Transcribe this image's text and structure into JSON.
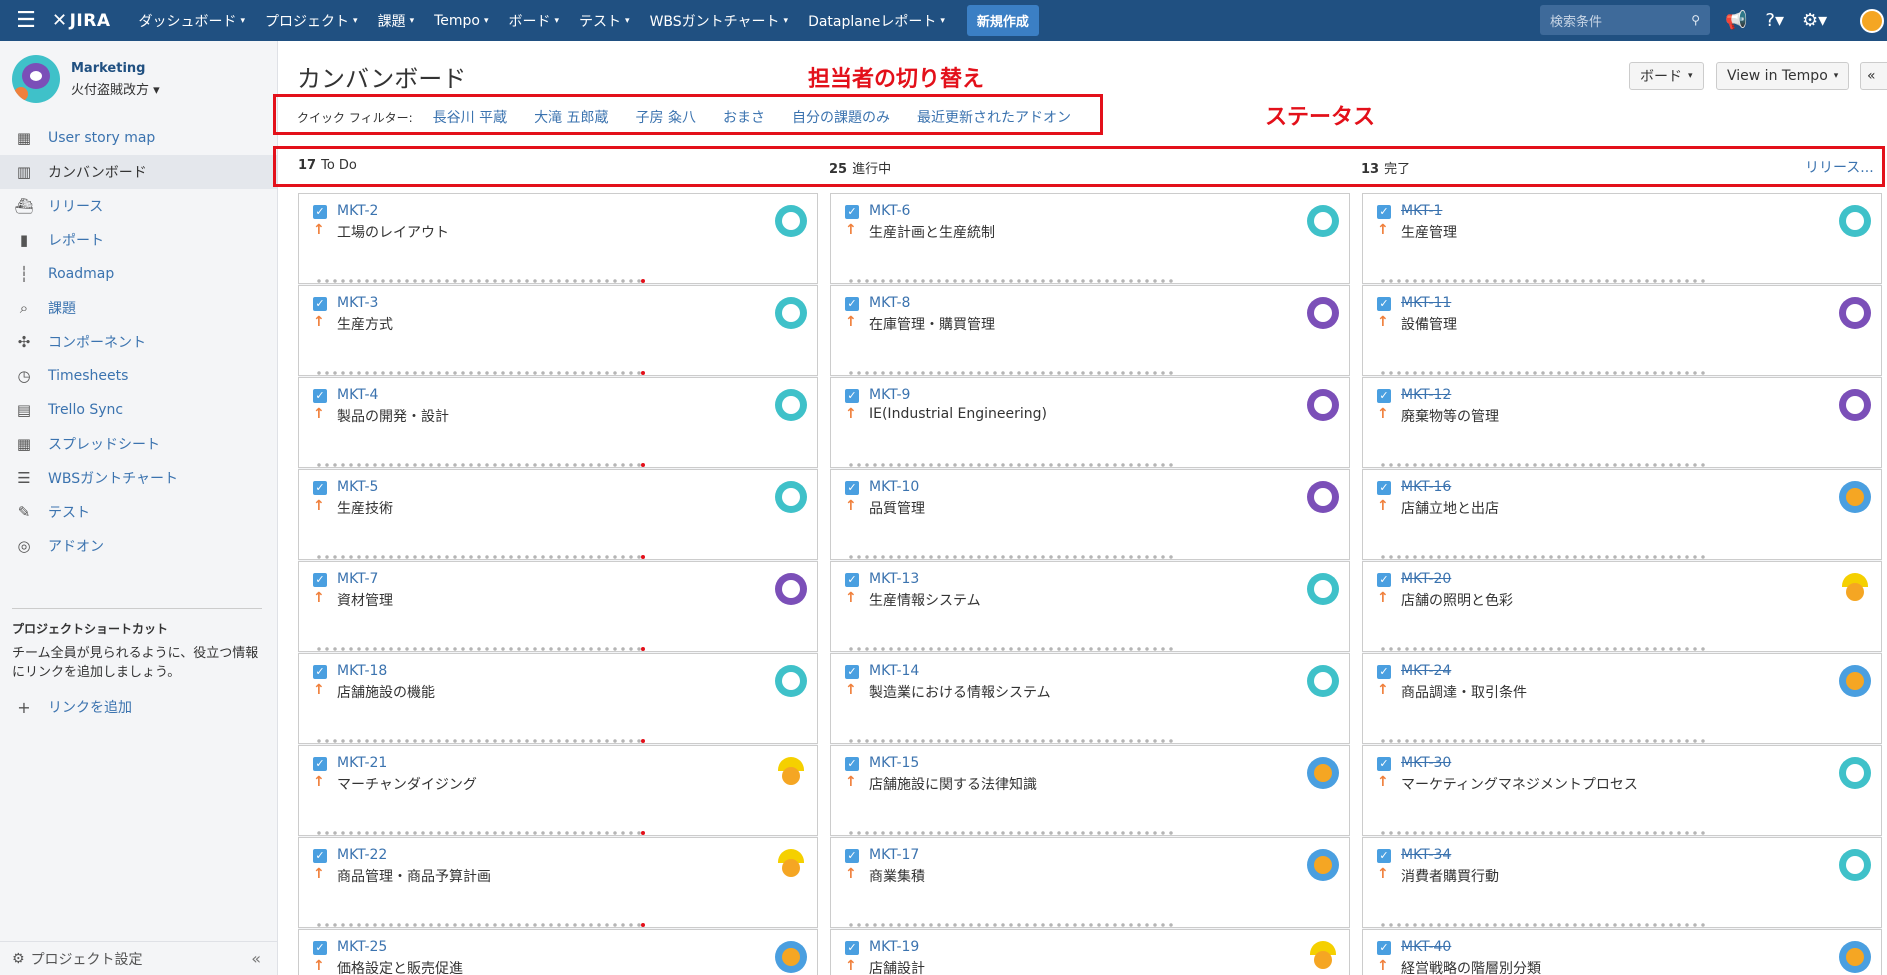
{
  "nav": {
    "logo": "JIRA",
    "items": [
      "ダッシュボード",
      "プロジェクト",
      "課題",
      "Tempo",
      "ボード",
      "テスト",
      "WBSガントチャート",
      "Dataplaneレポート"
    ],
    "create": "新規作成",
    "search_placeholder": "検索条件"
  },
  "project": {
    "name": "Marketing",
    "sub": "火付盗賊改方"
  },
  "sidebar": {
    "items": [
      {
        "label": "User story map",
        "icon": "story-map-icon"
      },
      {
        "label": "カンバンボード",
        "icon": "board-icon"
      },
      {
        "label": "リリース",
        "icon": "ship-icon"
      },
      {
        "label": "レポート",
        "icon": "chart-icon"
      },
      {
        "label": "Roadmap",
        "icon": "roadmap-icon"
      },
      {
        "label": "課題",
        "icon": "issues-icon"
      },
      {
        "label": "コンポーネント",
        "icon": "puzzle-icon"
      },
      {
        "label": "Timesheets",
        "icon": "clock-icon"
      },
      {
        "label": "Trello Sync",
        "icon": "trello-icon"
      },
      {
        "label": "スプレッドシート",
        "icon": "table-icon"
      },
      {
        "label": "WBSガントチャート",
        "icon": "gantt-icon"
      },
      {
        "label": "テスト",
        "icon": "test-icon"
      },
      {
        "label": "アドオン",
        "icon": "addon-icon"
      }
    ],
    "shortcut_title": "プロジェクトショートカット",
    "shortcut_text": "チーム全員が見られるように、役立つ情報にリンクを追加しましょう。",
    "add_link": "リンクを追加",
    "settings": "プロジェクト設定"
  },
  "board": {
    "title": "カンバンボード",
    "btn_board": "ボード",
    "btn_tempo": "View in Tempo",
    "annotation_assignee": "担当者の切り替え",
    "annotation_status": "ステータス",
    "quickfilter_label": "クイック フィルター:",
    "quickfilters": [
      "長谷川 平蔵",
      "大滝 五郎蔵",
      "子房 粂八",
      "おまさ",
      "自分の課題のみ",
      "最近更新されたアドオン"
    ],
    "release": "リリース..."
  },
  "columns": [
    {
      "count": "17",
      "name": "To Do",
      "cards": [
        {
          "key": "MKT-2",
          "summary": "工場のレイアウト",
          "avatar": "teal"
        },
        {
          "key": "MKT-3",
          "summary": "生産方式",
          "avatar": "teal"
        },
        {
          "key": "MKT-4",
          "summary": "製品の開発・設計",
          "avatar": "teal"
        },
        {
          "key": "MKT-5",
          "summary": "生産技術",
          "avatar": "teal"
        },
        {
          "key": "MKT-7",
          "summary": "資材管理",
          "avatar": "purple"
        },
        {
          "key": "MKT-18",
          "summary": "店舗施設の機能",
          "avatar": "teal"
        },
        {
          "key": "MKT-21",
          "summary": "マーチャンダイジング",
          "avatar": "worker"
        },
        {
          "key": "MKT-22",
          "summary": "商品管理・商品予算計画",
          "avatar": "worker"
        },
        {
          "key": "MKT-25",
          "summary": "価格設定と販売促進",
          "avatar": "cat"
        }
      ]
    },
    {
      "count": "25",
      "name": "進行中",
      "cards": [
        {
          "key": "MKT-6",
          "summary": "生産計画と生産統制",
          "avatar": "teal"
        },
        {
          "key": "MKT-8",
          "summary": "在庫管理・購買管理",
          "avatar": "purple"
        },
        {
          "key": "MKT-9",
          "summary": "IE(Industrial Engineering)",
          "avatar": "purple"
        },
        {
          "key": "MKT-10",
          "summary": "品質管理",
          "avatar": "purple"
        },
        {
          "key": "MKT-13",
          "summary": "生産情報システム",
          "avatar": "teal"
        },
        {
          "key": "MKT-14",
          "summary": "製造業における情報システム",
          "avatar": "teal"
        },
        {
          "key": "MKT-15",
          "summary": "店舗施設に関する法律知識",
          "avatar": "cat"
        },
        {
          "key": "MKT-17",
          "summary": "商業集積",
          "avatar": "cat"
        },
        {
          "key": "MKT-19",
          "summary": "店舗設計",
          "avatar": "worker"
        }
      ]
    },
    {
      "count": "13",
      "name": "完了",
      "cards": [
        {
          "key": "MKT-1",
          "summary": "生産管理",
          "avatar": "teal"
        },
        {
          "key": "MKT-11",
          "summary": "設備管理",
          "avatar": "purple"
        },
        {
          "key": "MKT-12",
          "summary": "廃棄物等の管理",
          "avatar": "purple"
        },
        {
          "key": "MKT-16",
          "summary": "店舗立地と出店",
          "avatar": "cat"
        },
        {
          "key": "MKT-20",
          "summary": "店舗の照明と色彩",
          "avatar": "worker"
        },
        {
          "key": "MKT-24",
          "summary": "商品調達・取引条件",
          "avatar": "cat"
        },
        {
          "key": "MKT-30",
          "summary": "マーケティングマネジメントプロセス",
          "avatar": "teal"
        },
        {
          "key": "MKT-34",
          "summary": "消費者購買行動",
          "avatar": "teal"
        },
        {
          "key": "MKT-40",
          "summary": "経営戦略の階層別分類",
          "avatar": "cat"
        }
      ]
    }
  ]
}
